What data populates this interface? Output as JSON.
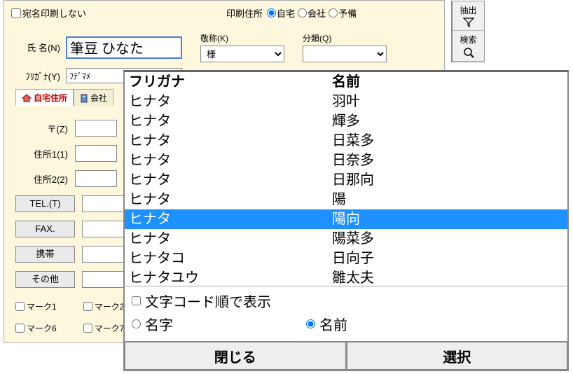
{
  "top": {
    "no_print_label": "宛名印刷しない",
    "print_addr_label": "印刷住所",
    "radio_home": "自宅",
    "radio_office": "会社",
    "radio_spare": "予備"
  },
  "toolbar": {
    "extract": "抽出",
    "search": "検索"
  },
  "form": {
    "name_label": "氏 名(N)",
    "name_value": "筆豆 ひなた",
    "furigana_label": "ﾌﾘｶﾞﾅ(Y)",
    "furigana_value": "ﾌﾃﾞﾏﾒ",
    "keishou_label": "敬称(K)",
    "keishou_value": "様",
    "bunrui_label": "分類(Q)",
    "bunrui_value": ""
  },
  "tabs": {
    "home": "自宅住所",
    "office": "会社"
  },
  "address": {
    "postal": "〒(Z)",
    "addr1": "住所1(1)",
    "addr2": "住所2(2)",
    "tel": "TEL.(T)",
    "fax": "FAX.",
    "mobile": "携帯",
    "other": "その他"
  },
  "marks": {
    "m1": "マーク1",
    "m2": "マーク2",
    "m6": "マーク6",
    "m7": "マーク7"
  },
  "popup": {
    "header_furigana": "フリガナ",
    "header_name": "名前",
    "items": [
      {
        "furigana": "ヒナタ",
        "name": "羽叶"
      },
      {
        "furigana": "ヒナタ",
        "name": "輝多"
      },
      {
        "furigana": "ヒナタ",
        "name": "日菜多"
      },
      {
        "furigana": "ヒナタ",
        "name": "日奈多"
      },
      {
        "furigana": "ヒナタ",
        "name": "日那向"
      },
      {
        "furigana": "ヒナタ",
        "name": "陽"
      },
      {
        "furigana": "ヒナタ",
        "name": "陽向",
        "selected": true
      },
      {
        "furigana": "ヒナタ",
        "name": "陽菜多"
      },
      {
        "furigana": "ヒナタコ",
        "name": "日向子"
      },
      {
        "furigana": "ヒナタユウ",
        "name": "雛太夫"
      }
    ],
    "sort_by_code": "文字コード順で表示",
    "radio_surname": "名字",
    "radio_givenname": "名前",
    "close_btn": "閉じる",
    "select_btn": "選択"
  }
}
